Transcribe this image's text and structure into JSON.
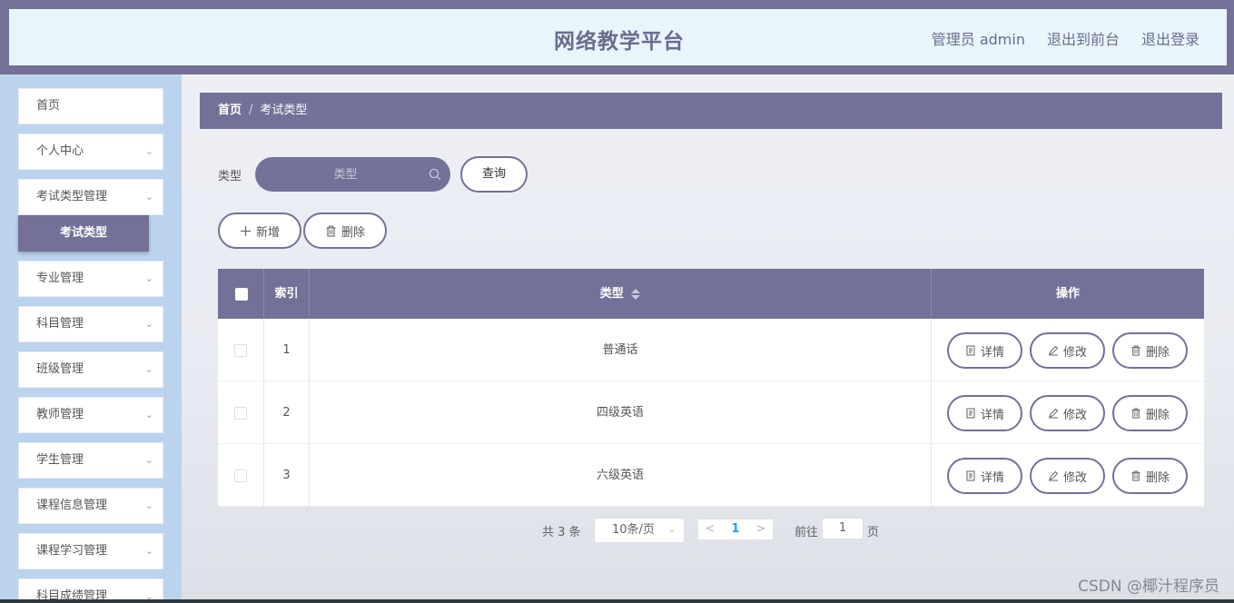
{
  "header": {
    "title": "网络教学平台",
    "user_label": "管理员 admin",
    "front_link": "退出到前台",
    "logout_link": "退出登录"
  },
  "sidebar": {
    "items": [
      {
        "label": "首页",
        "expandable": false
      },
      {
        "label": "个人中心",
        "expandable": true
      },
      {
        "label": "考试类型管理",
        "expandable": true
      },
      {
        "label": "专业管理",
        "expandable": true
      },
      {
        "label": "科目管理",
        "expandable": true
      },
      {
        "label": "班级管理",
        "expandable": true
      },
      {
        "label": "教师管理",
        "expandable": true
      },
      {
        "label": "学生管理",
        "expandable": true
      },
      {
        "label": "课程信息管理",
        "expandable": true
      },
      {
        "label": "课程学习管理",
        "expandable": true
      },
      {
        "label": "科目成绩管理",
        "expandable": true
      }
    ],
    "active_submenu": "考试类型"
  },
  "breadcrumb": {
    "home": "首页",
    "separator": "/",
    "current": "考试类型"
  },
  "search": {
    "label": "类型",
    "placeholder": "类型",
    "query_button": "查询"
  },
  "actions": {
    "add": "新增",
    "delete": "删除"
  },
  "table": {
    "columns": {
      "index": "索引",
      "type": "类型",
      "ops": "操作"
    },
    "rows": [
      {
        "index": "1",
        "type": "普通话"
      },
      {
        "index": "2",
        "type": "四级英语"
      },
      {
        "index": "3",
        "type": "六级英语"
      }
    ],
    "row_buttons": {
      "detail": "详情",
      "edit": "修改",
      "delete": "删除"
    }
  },
  "pagination": {
    "total": "共 3 条",
    "page_size": "10条/页",
    "prev": "<",
    "current_page": "1",
    "next": ">",
    "goto_label": "前往",
    "goto_value": "1",
    "page_suffix": "页"
  },
  "watermark": "CSDN @椰汁程序员",
  "colors": {
    "accent": "#737197",
    "header_bg": "#e8f6fc",
    "sidebar_bg": "#bcd3ee",
    "page_link": "#20a0ff"
  }
}
